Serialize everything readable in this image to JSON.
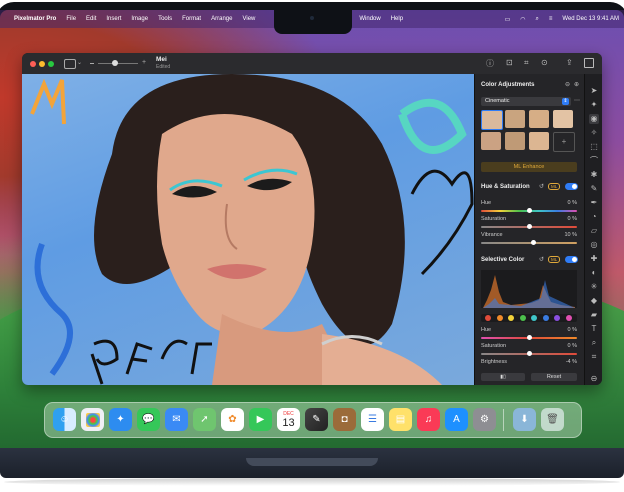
{
  "menubar": {
    "app_name": "Pixelmator Pro",
    "menus": [
      "File",
      "Edit",
      "Insert",
      "Image",
      "Tools",
      "Format",
      "Arrange",
      "View",
      "Window",
      "Help"
    ],
    "datetime": "Wed Dec 13  9:41 AM"
  },
  "window": {
    "doc_title": "Mei",
    "doc_subtitle": "Edited"
  },
  "panel": {
    "title": "Color Adjustments",
    "preset": "Cinematic",
    "ml_enhance": "ML Enhance",
    "hue_sat_title": "Hue & Saturation",
    "ml_badge": "ML",
    "hue_label": "Hue",
    "hue_value": "0 %",
    "saturation_label": "Saturation",
    "saturation_value": "0 %",
    "vibrance_label": "Vibrance",
    "vibrance_value": "10 %",
    "hue_level": 0.5,
    "saturation_level": 0.5,
    "vibrance_level": 0.55,
    "selective_title": "Selective Color",
    "sc_hue_label": "Hue",
    "sc_hue_value": "0 %",
    "sc_saturation_label": "Saturation",
    "sc_saturation_value": "0 %",
    "sc_brightness_label": "Brightness",
    "sc_brightness_value": "-4 %",
    "reset_label": "Reset",
    "swatch_colors": [
      "#e04b3a",
      "#f08a2a",
      "#f3d33a",
      "#4cc04c",
      "#3fc5c8",
      "#3a7be0",
      "#8a4fe0",
      "#e04fb0"
    ]
  },
  "dock": {
    "calendar_month": "DEC",
    "calendar_day": "13",
    "apps": [
      "finder-icon",
      "launchpad-icon",
      "safari-icon",
      "messages-icon",
      "mail-icon",
      "maps-icon",
      "photos-icon",
      "facetime-icon",
      "calendar-icon",
      "pixelmator-icon",
      "notes-brown-icon",
      "reminders-icon",
      "notes-icon",
      "music-icon",
      "app-store-icon",
      "settings-icon",
      "downloads-icon",
      "trash-icon"
    ]
  },
  "colors": {
    "accent": "#2f7cf6",
    "panel_bg": "#252528",
    "ml_enhance": "#e0a93a"
  }
}
